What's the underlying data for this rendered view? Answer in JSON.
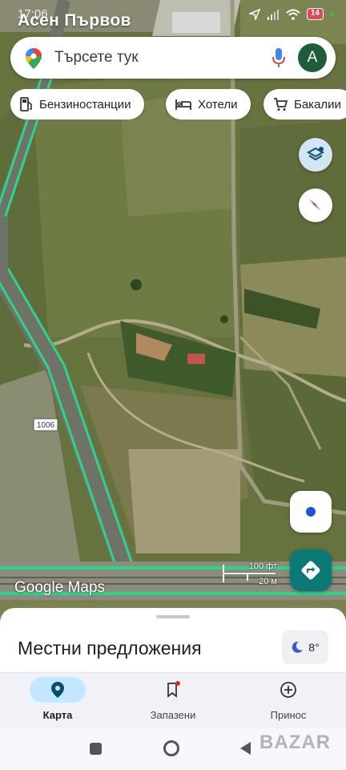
{
  "status_bar": {
    "time": "17:06",
    "place_name": "Асен Първов",
    "battery": "14"
  },
  "search": {
    "placeholder": "Търсете тук",
    "avatar_letter": "A"
  },
  "chips": [
    {
      "label": "Бензиностанции",
      "icon": "gas-station-icon"
    },
    {
      "label": "Хотели",
      "icon": "bed-icon"
    },
    {
      "label": "Бакалии",
      "icon": "cart-icon"
    }
  ],
  "map": {
    "road_label": "1006",
    "logo": "Google Maps",
    "scale_imperial": "100 фт",
    "scale_metric": "20 м"
  },
  "sheet": {
    "title": "Местни предложения",
    "temperature": "8°"
  },
  "nav": [
    {
      "label": "Карта",
      "icon": "map-pin-icon",
      "active": true
    },
    {
      "label": "Запазени",
      "icon": "bookmark-icon",
      "active": false
    },
    {
      "label": "Принос",
      "icon": "add-circle-icon",
      "active": false
    }
  ],
  "watermark": "BAZAR",
  "colors": {
    "accent": "#0b7a77",
    "active_pill": "#c2e7ff",
    "road_highlight": "#2fd28a"
  }
}
